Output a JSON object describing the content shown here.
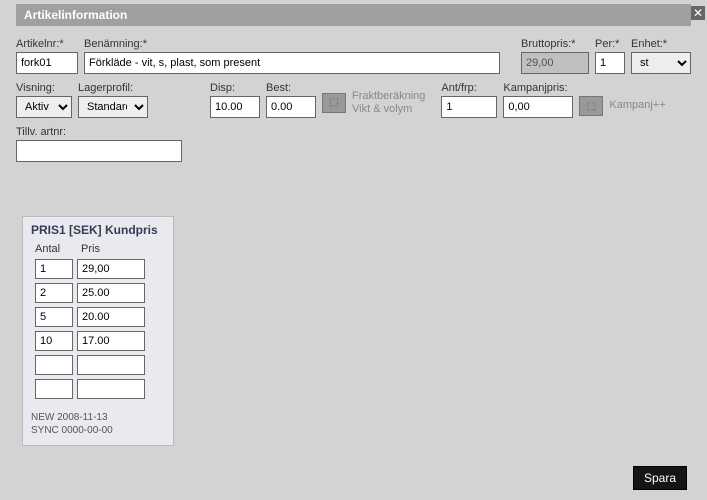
{
  "header": {
    "title": "Artikelinformation"
  },
  "row1": {
    "artikelnr": {
      "label": "Artikelnr:*",
      "value": "fork01"
    },
    "benamning": {
      "label": "Benämning:*",
      "value": "Förkläde - vit, s, plast, som present"
    },
    "bruttopris": {
      "label": "Bruttopris:*",
      "value": "29,00"
    },
    "per": {
      "label": "Per:*",
      "value": "1"
    },
    "enhet": {
      "label": "Enhet:*",
      "value": "st"
    }
  },
  "row2": {
    "visning": {
      "label": "Visning:",
      "value": "Aktiv"
    },
    "lagerprofil": {
      "label": "Lagerprofil:",
      "value": "Standard"
    },
    "disp": {
      "label": "Disp:",
      "value": "10.00"
    },
    "best": {
      "label": "Best:",
      "value": "0.00"
    },
    "frakt": {
      "line1": "Fraktberäkning",
      "line2": "Vikt & volym"
    },
    "antfrp": {
      "label": "Ant/frp:",
      "value": "1"
    },
    "kampanjpris": {
      "label": "Kampanjpris:",
      "value": "0,00"
    },
    "kampanjpp": {
      "label": "Kampanj++"
    }
  },
  "row3": {
    "tillv": {
      "label": "Tillv. artnr:",
      "value": ""
    }
  },
  "chart_data": {
    "type": "table",
    "title": "PRIS1 [SEK] Kundpris",
    "columns": [
      "Antal",
      "Pris"
    ],
    "rows": [
      {
        "antal": "1",
        "pris": "29,00"
      },
      {
        "antal": "2",
        "pris": "25.00"
      },
      {
        "antal": "5",
        "pris": "20.00"
      },
      {
        "antal": "10",
        "pris": "17.00"
      },
      {
        "antal": "",
        "pris": ""
      },
      {
        "antal": "",
        "pris": ""
      }
    ]
  },
  "sync": {
    "new": "NEW 2008-11-13",
    "sync": "SYNC 0000-00-00"
  },
  "footer": {
    "save": "Spara"
  }
}
